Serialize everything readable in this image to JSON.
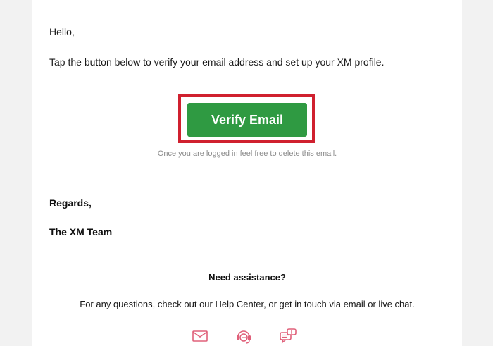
{
  "email": {
    "greeting": "Hello,",
    "intro": "Tap the button below to verify your email address and set up your XM profile.",
    "verify_button_label": "Verify Email",
    "delete_note": "Once you are logged in feel free to delete this email.",
    "regards": "Regards,",
    "signature": "The XM Team"
  },
  "footer": {
    "assistance_title": "Need assistance?",
    "assistance_text": "For any questions, check out our Help Center, or get in touch via email or live chat.",
    "icons": [
      "mail-icon",
      "support-headset-icon",
      "live-chat-icon"
    ]
  },
  "colors": {
    "button_green": "#2f9a42",
    "highlight_red": "#d0202f",
    "icon_pink": "#e0607a",
    "page_background": "#f2f2f2"
  }
}
